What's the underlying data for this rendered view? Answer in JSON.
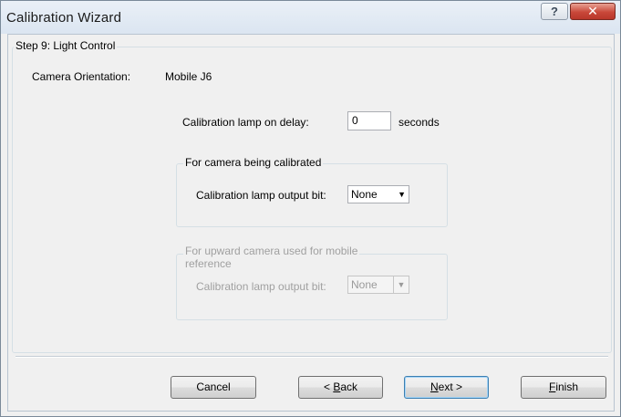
{
  "window": {
    "title": "Calibration Wizard",
    "help_glyph": "?",
    "close_glyph": "✕",
    "icons": {
      "help": "help-icon",
      "close": "close-icon"
    }
  },
  "step": {
    "legend": "Step 9: Light Control",
    "camera_orientation_label": "Camera Orientation:",
    "camera_orientation_value": "Mobile J6"
  },
  "lamp_delay": {
    "label": "Calibration lamp on delay:",
    "value": "0",
    "unit": "seconds"
  },
  "group_calibrated": {
    "legend": "For camera being calibrated",
    "output_label": "Calibration lamp output bit:",
    "selected": "None"
  },
  "group_upward": {
    "legend_line1": "For upward camera used for mobile",
    "legend_line2": "reference",
    "output_label": "Calibration lamp output bit:",
    "selected": "None",
    "enabled": false
  },
  "buttons": {
    "cancel": "Cancel",
    "back_prefix": "< ",
    "back_mnemonic": "B",
    "back_rest": "ack",
    "next_mnemonic": "N",
    "next_rest": "ext >",
    "finish_mnemonic": "F",
    "finish_rest": "inish"
  },
  "colors": {
    "close_button": "#c9483a",
    "disabled_text": "#a0a0a0",
    "default_button_border": "#3c7fb1"
  }
}
